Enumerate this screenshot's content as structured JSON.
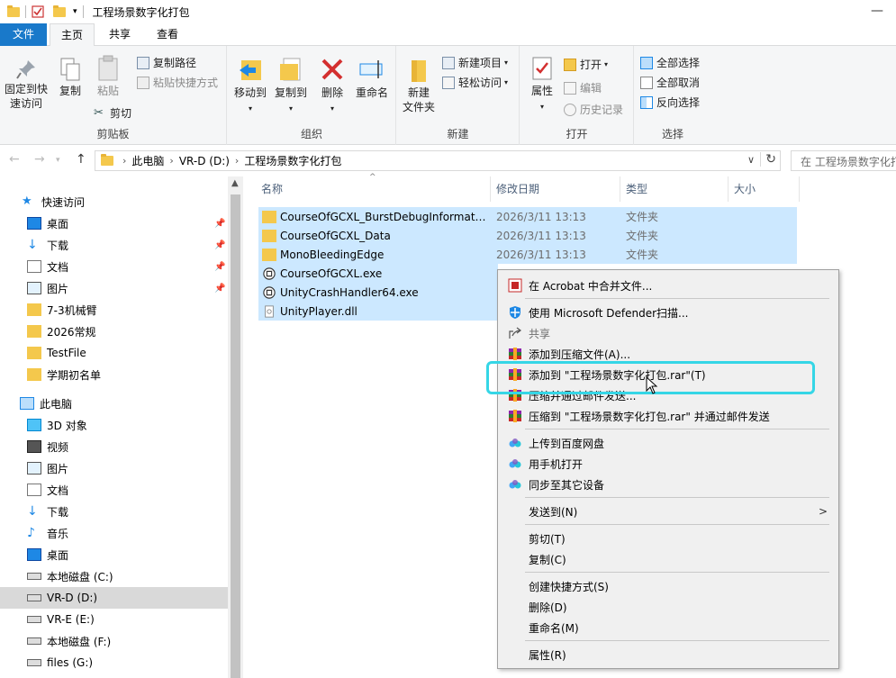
{
  "window": {
    "title": "工程场景数字化打包",
    "minimize_glyph": "—"
  },
  "ribbon_tabs": [
    "文件",
    "主页",
    "共享",
    "查看"
  ],
  "ribbon": {
    "clipboard": {
      "pin_label_1": "固定到快",
      "pin_label_2": "速访问",
      "copy": "复制",
      "paste": "粘贴",
      "copy_path": "复制路径",
      "paste_shortcut": "粘贴快捷方式",
      "cut": "剪切",
      "group": "剪贴板"
    },
    "organize": {
      "move_to": "移动到",
      "copy_to": "复制到",
      "delete": "删除",
      "rename": "重命名",
      "group": "组织"
    },
    "new": {
      "new_folder_1": "新建",
      "new_folder_2": "文件夹",
      "new_item": "新建项目",
      "easy_access": "轻松访问",
      "group": "新建"
    },
    "open": {
      "properties": "属性",
      "open": "打开",
      "edit": "编辑",
      "history": "历史记录",
      "group": "打开"
    },
    "select": {
      "select_all": "全部选择",
      "select_none": "全部取消",
      "invert": "反向选择",
      "group": "选择"
    }
  },
  "address": {
    "crumbs": [
      "此电脑",
      "VR-D (D:)",
      "工程场景数字化打包"
    ],
    "search_placeholder": "在 工程场景数字化打包"
  },
  "nav_pane": {
    "quick_access": "快速访问",
    "quick_items": [
      "桌面",
      "下载",
      "文档",
      "图片",
      "7-3机械臂",
      "2026常规",
      "TestFile",
      "学期初名单"
    ],
    "this_pc": "此电脑",
    "pc_items": [
      "3D 对象",
      "视频",
      "图片",
      "文档",
      "下载",
      "音乐",
      "桌面",
      "本地磁盘 (C:)",
      "VR-D (D:)",
      "VR-E (E:)",
      "本地磁盘 (F:)",
      "files (G:)"
    ]
  },
  "columns": [
    "名称",
    "修改日期",
    "类型",
    "大小"
  ],
  "files": [
    {
      "name": "CourseOfGCXL_BurstDebugInformati...",
      "date": "2026/3/11 13:13",
      "type": "文件夹",
      "kind": "folder"
    },
    {
      "name": "CourseOfGCXL_Data",
      "date": "2026/3/11 13:13",
      "type": "文件夹",
      "kind": "folder"
    },
    {
      "name": "MonoBleedingEdge",
      "date": "2026/3/11 13:13",
      "type": "文件夹",
      "kind": "folder"
    },
    {
      "name": "CourseOfGCXL.exe",
      "date": "",
      "type": "",
      "kind": "unity"
    },
    {
      "name": "UnityCrashHandler64.exe",
      "date": "",
      "type": "",
      "kind": "unity"
    },
    {
      "name": "UnityPlayer.dll",
      "date": "",
      "type": "",
      "kind": "dll"
    }
  ],
  "context_menu": {
    "acrobat": "在 Acrobat 中合并文件...",
    "defender": "使用 Microsoft Defender扫描...",
    "share": "共享",
    "add_archive": "添加到压缩文件(A)...",
    "add_to_rar": "添加到 \"工程场景数字化打包.rar\"(T)",
    "compress_email": "压缩并通过邮件发送...",
    "compress_rar_email": "压缩到 \"工程场景数字化打包.rar\" 并通过邮件发送",
    "baidu_upload": "上传到百度网盘",
    "phone_open": "用手机打开",
    "sync_devices": "同步至其它设备",
    "send_to": "发送到(N)",
    "cut": "剪切(T)",
    "copy": "复制(C)",
    "create_shortcut": "创建快捷方式(S)",
    "delete": "删除(D)",
    "rename": "重命名(M)",
    "properties": "属性(R)"
  },
  "colors": {
    "accent": "#1979ca",
    "selection": "#cce8ff",
    "highlight_box": "#35d6e6"
  }
}
